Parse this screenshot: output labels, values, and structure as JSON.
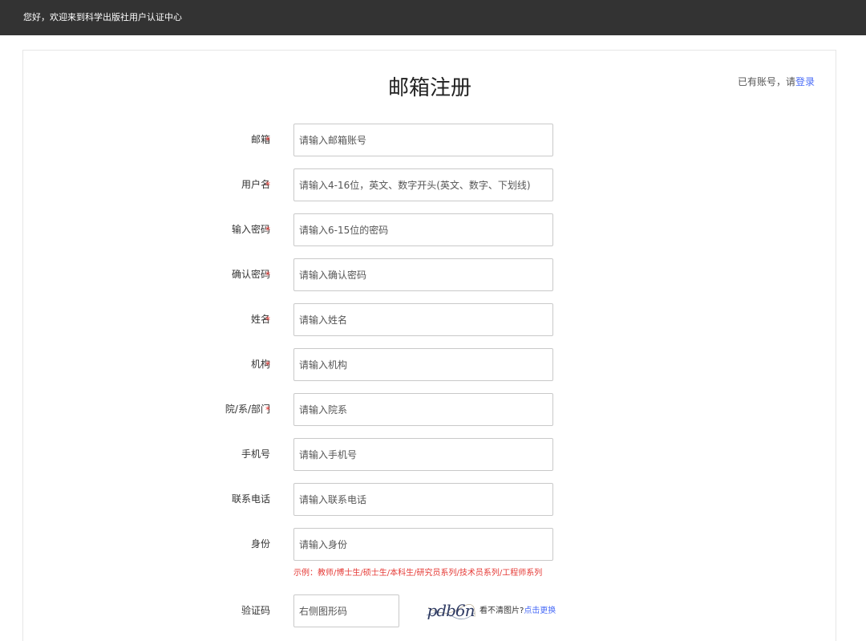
{
  "header": {
    "welcome": "您好，欢迎来到科学出版社用户认证中心"
  },
  "page": {
    "title": "邮箱注册",
    "login_prefix": "已有账号，请",
    "login_link": "登录"
  },
  "form": {
    "required_mark": "*",
    "fields": [
      {
        "label": "邮箱",
        "placeholder": "请输入邮箱账号"
      },
      {
        "label": "用户名",
        "placeholder": "请输入4-16位，英文、数字开头(英文、数字、下划线)"
      },
      {
        "label": "输入密码",
        "placeholder": "请输入6-15位的密码"
      },
      {
        "label": "确认密码",
        "placeholder": "请输入确认密码"
      },
      {
        "label": "姓名",
        "placeholder": "请输入姓名"
      },
      {
        "label": "机构",
        "placeholder": "请输入机构"
      },
      {
        "label": "院/系/部门",
        "placeholder": "请输入院系"
      },
      {
        "label": "手机号",
        "placeholder": "请输入手机号"
      },
      {
        "label": "联系电话",
        "placeholder": "请输入联系电话"
      },
      {
        "label": "身份",
        "placeholder": "请输入身份"
      }
    ],
    "identity_example": "示例：教师/博士生/硕士生/本科生/研究员系列/技术员系列/工程师系列",
    "captcha": {
      "label": "验证码",
      "placeholder": "右侧图形码",
      "image_text": "pdb6n",
      "hint": "看不清图片?",
      "refresh_link": "点击更换"
    }
  },
  "colors": {
    "topbar": "#333333",
    "link": "#4a6cf7",
    "required": "#e53935"
  }
}
